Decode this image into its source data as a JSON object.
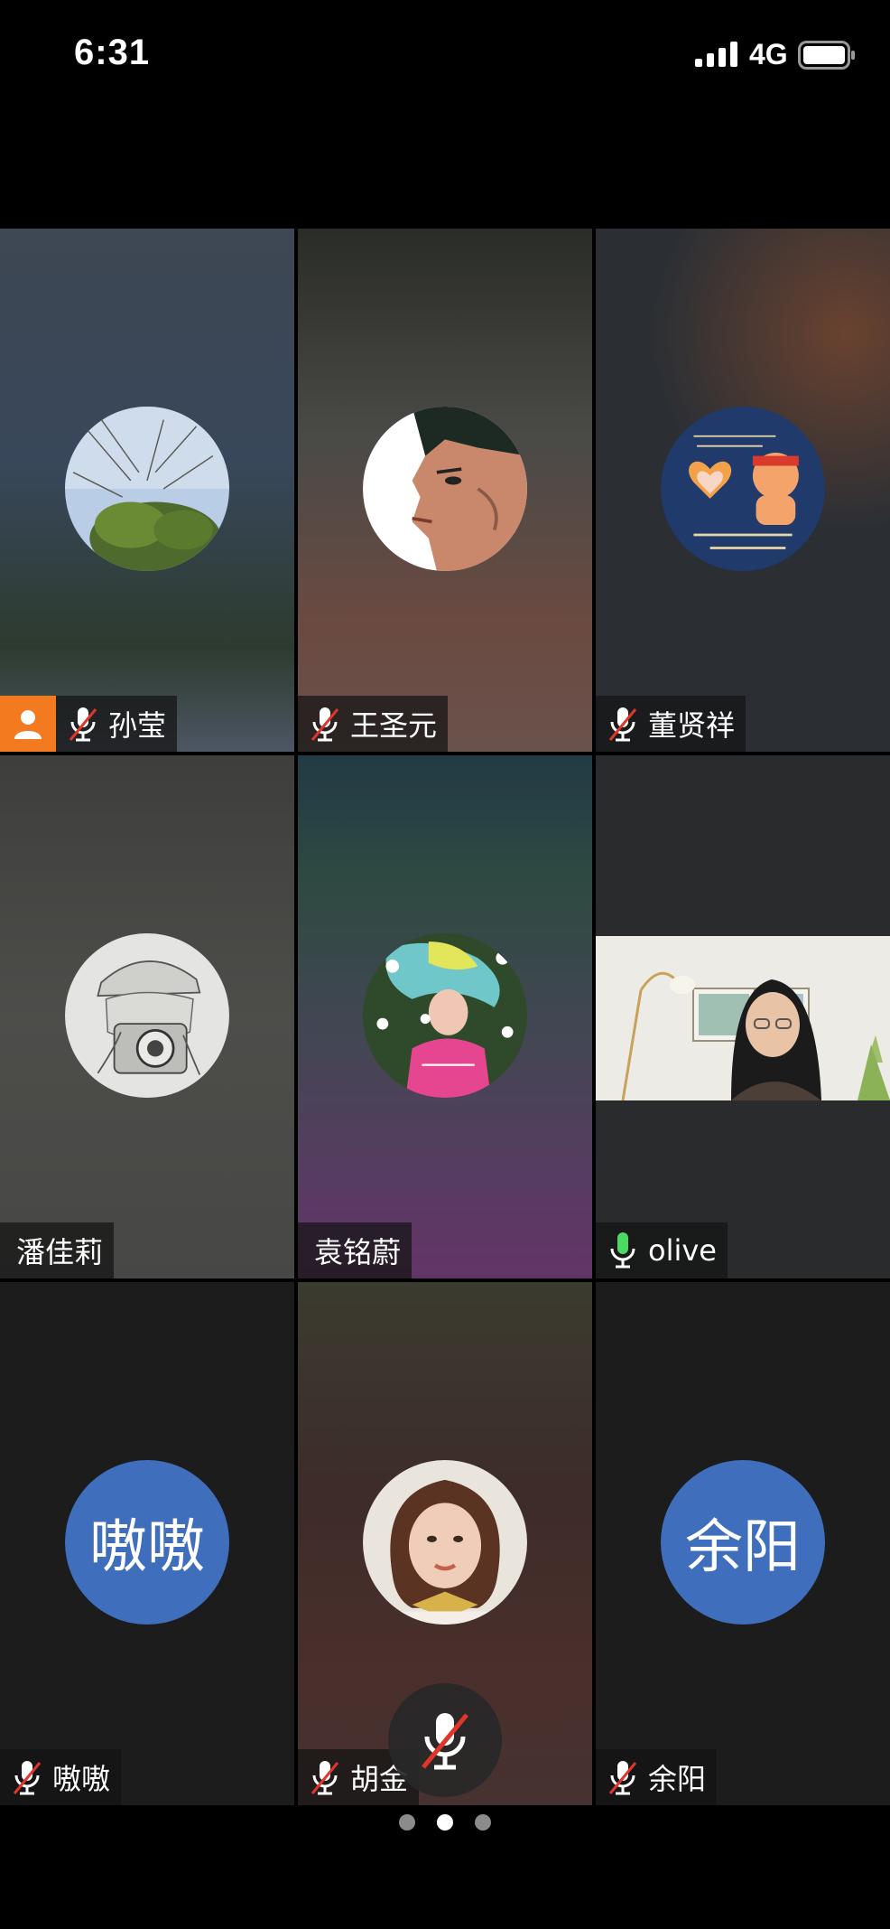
{
  "status_bar": {
    "time": "6:31",
    "network": "4G"
  },
  "participants": [
    {
      "name": "孙莹",
      "mic": "muted",
      "is_host": true,
      "avatar": "tree-photo-avatar"
    },
    {
      "name": "王圣元",
      "mic": "muted",
      "is_host": false,
      "avatar": "cartoon-man-avatar"
    },
    {
      "name": "董贤祥",
      "mic": "muted",
      "is_host": false,
      "avatar": "cat-heart-avatar"
    },
    {
      "name": "潘佳莉",
      "mic": "none",
      "is_host": false,
      "avatar": "sketch-camera-avatar"
    },
    {
      "name": "袁铭蔚",
      "mic": "none",
      "is_host": false,
      "avatar": "flower-girl-avatar"
    },
    {
      "name": "olive",
      "mic": "active",
      "is_host": false,
      "avatar": "live-video"
    },
    {
      "name": "嗷嗷",
      "mic": "muted",
      "is_host": false,
      "avatar_initials": "嗷嗷"
    },
    {
      "name": "胡金",
      "mic": "muted",
      "is_host": false,
      "avatar": "girl-photo-avatar"
    },
    {
      "name": "余阳",
      "mic": "muted",
      "is_host": false,
      "avatar_initials": "余阳"
    }
  ],
  "pager": {
    "pages": 3,
    "current": 2
  },
  "colors": {
    "host_badge": "#f47a1f",
    "initials_avatar": "#3f6fbc",
    "mic_active": "#4cd964",
    "mute_slash": "#e0352b"
  }
}
